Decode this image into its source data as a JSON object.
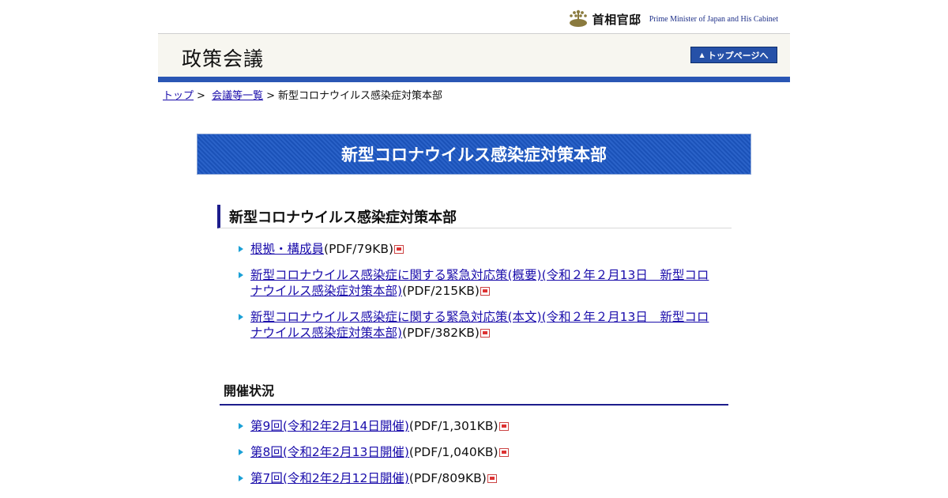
{
  "brand": {
    "name_ja": "首相官邸",
    "name_en": "Prime Minister of Japan and His Cabinet"
  },
  "header": {
    "title": "政策会議",
    "top_button": "トップページへ"
  },
  "breadcrumb": {
    "items": [
      "トップ",
      "会議等一覧"
    ],
    "separator": ">",
    "current": "新型コロナウイルス感染症対策本部"
  },
  "main_title": "新型コロナウイルス感染症対策本部",
  "section": {
    "title": "新型コロナウイルス感染症対策本部",
    "links": [
      {
        "label": "根拠・構成員",
        "suffix": "(PDF/79KB)"
      },
      {
        "label": "新型コロナウイルス感染症に関する緊急対応策(概要)(令和２年２月13日　新型コロナウイルス感染症対策本部)",
        "suffix": "(PDF/215KB)"
      },
      {
        "label": "新型コロナウイルス感染症に関する緊急対応策(本文)(令和２年２月13日　新型コロナウイルス感染症対策本部)",
        "suffix": "(PDF/382KB)"
      }
    ]
  },
  "status": {
    "title": "開催状況",
    "links": [
      {
        "label": "第9回(令和2年2月14日開催)",
        "suffix": "(PDF/1,301KB)"
      },
      {
        "label": "第8回(令和2年2月13日開催)",
        "suffix": "(PDF/1,040KB)"
      },
      {
        "label": "第7回(令和2年2月12日開催)",
        "suffix": "(PDF/809KB)"
      }
    ]
  },
  "colors": {
    "header_bg": "#f7f6f0",
    "accent_blue": "#2a56b4",
    "title_blue": "#1b52b8",
    "link": "#1a0dab",
    "bullet": "#1aa0d6"
  },
  "icons": {
    "bullet": "triangle-right-icon",
    "pdf": "pdf-icon",
    "emblem": "paulownia-emblem-icon"
  }
}
